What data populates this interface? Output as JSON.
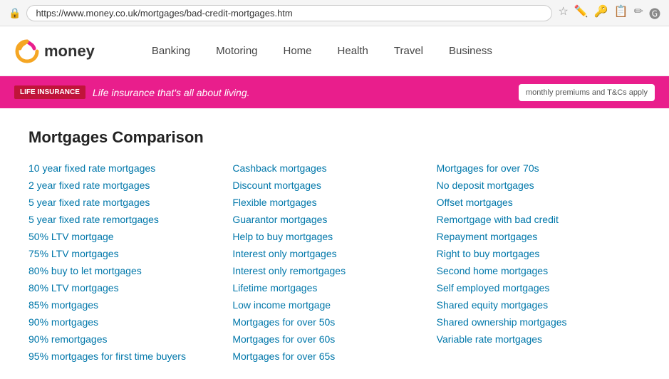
{
  "addressBar": {
    "url": "https://www.money.co.uk/mortgages/bad-credit-mortgages.htm"
  },
  "nav": {
    "logoText": "money",
    "links": [
      "Banking",
      "Motoring",
      "Home",
      "Health",
      "Travel",
      "Business"
    ]
  },
  "banner": {
    "badge": "LIFE INSURANCE",
    "text": "Life insurance that's all about living.",
    "rightText": "monthly premiums and T&Cs apply"
  },
  "main": {
    "title": "Mortgages Comparison",
    "columns": [
      [
        "10 year fixed rate mortgages",
        "2 year fixed rate mortgages",
        "5 year fixed rate mortgages",
        "5 year fixed rate remortgages",
        "50% LTV mortgage",
        "75% LTV mortgages",
        "80% buy to let mortgages",
        "80% LTV mortgages",
        "85% mortgages",
        "90% mortgages",
        "90% remortgages",
        "95% mortgages for first time buyers"
      ],
      [
        "Cashback mortgages",
        "Discount mortgages",
        "Flexible mortgages",
        "Guarantor mortgages",
        "Help to buy mortgages",
        "Interest only mortgages",
        "Interest only remortgages",
        "Lifetime mortgages",
        "Low income mortgage",
        "Mortgages for over 50s",
        "Mortgages for over 60s",
        "Mortgages for over 65s"
      ],
      [
        "Mortgages for over 70s",
        "No deposit mortgages",
        "Offset mortgages",
        "Remortgage with bad credit",
        "Repayment mortgages",
        "Right to buy mortgages",
        "Second home mortgages",
        "Self employed mortgages",
        "Shared equity mortgages",
        "Shared ownership mortgages",
        "Variable rate mortgages"
      ]
    ]
  }
}
